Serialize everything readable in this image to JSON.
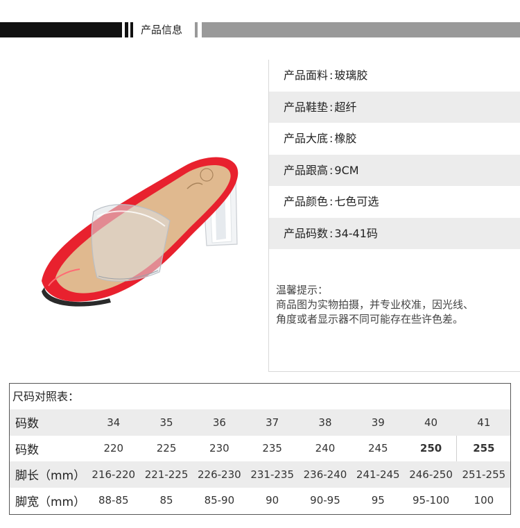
{
  "header": {
    "title": "产品信息"
  },
  "specs": [
    {
      "label": "产品面料",
      "value": "玻璃胶"
    },
    {
      "label": "产品鞋垫",
      "value": "超纤"
    },
    {
      "label": "产品大底",
      "value": "橡胶"
    },
    {
      "label": "产品跟高",
      "value": "9CM"
    },
    {
      "label": "产品颜色",
      "value": "七色可选"
    },
    {
      "label": "产品码数",
      "value": "34-41码"
    }
  ],
  "notice": {
    "title": "温馨提示：",
    "line1": "商品图为实物拍摄，并专业校准，因光线、",
    "line2": "角度或者显示器不同可能存在些许色差。"
  },
  "size_table": {
    "caption": "尺码对照表：",
    "rows": [
      {
        "label": "码数",
        "cells": [
          "34",
          "35",
          "36",
          "37",
          "38",
          "39",
          "40",
          "41"
        ]
      },
      {
        "label": "码数",
        "cells": [
          "220",
          "225",
          "230",
          "235",
          "240",
          "245",
          "250",
          "255"
        ]
      },
      {
        "label": "脚长（mm）",
        "cells": [
          "216-220",
          "221-225",
          "226-230",
          "231-235",
          "236-240",
          "241-245",
          "246-250",
          "251-255"
        ]
      },
      {
        "label": "脚宽（mm）",
        "cells": [
          "88-85",
          "85",
          "85-90",
          "90",
          "90-95",
          "95",
          "95-100",
          "100"
        ]
      }
    ]
  },
  "colors": {
    "accent_red": "#e8212e",
    "insole": "#e0b98f",
    "banner_dark": "#111111",
    "banner_gray": "#999999"
  }
}
